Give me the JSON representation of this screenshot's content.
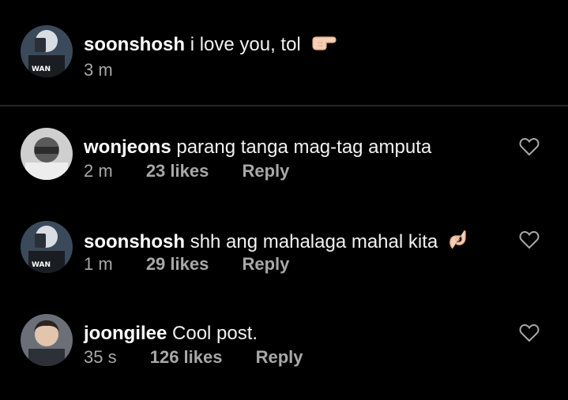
{
  "caption": {
    "username": "soonshosh",
    "text": "i love you, tol",
    "emoji": "pointing-hand-emoji",
    "time": "3 m"
  },
  "comments": [
    {
      "username": "wonjeons",
      "text": "parang tanga mag-tag amputa",
      "time": "2 m",
      "likes": "23 likes",
      "reply": "Reply"
    },
    {
      "username": "soonshosh",
      "text": "shh ang mahalaga mahal kita",
      "emoji": "ok-hand-emoji",
      "time": "1 m",
      "likes": "29 likes",
      "reply": "Reply"
    },
    {
      "username": "joongilee",
      "text": "Cool post.",
      "time": "35 s",
      "likes": "126 likes",
      "reply": "Reply"
    }
  ],
  "colors": {
    "background": "#000000",
    "primary_text": "#ffffff",
    "secondary_text": "#a8a8a8",
    "divider": "#262626"
  }
}
